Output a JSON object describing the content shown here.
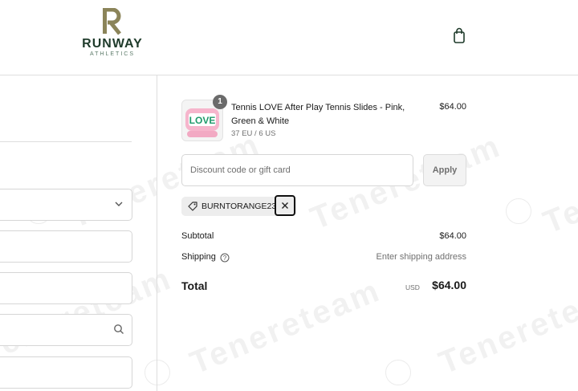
{
  "brand": {
    "name": "RUNWAY",
    "tagline": "ATHLETICS",
    "accent": "#1f3b2b",
    "monogram_color": "#8b8459"
  },
  "header": {
    "cart_icon": "shopping-bag-icon"
  },
  "cart_item": {
    "quantity": "1",
    "name": "Tennis LOVE After Play Tennis Slides - Pink, Green & White",
    "variant": "37 EU / 6 US",
    "price": "$64.00",
    "image_text": "LOVE"
  },
  "discount": {
    "placeholder": "Discount code or gift card",
    "value": "",
    "apply_label": "Apply"
  },
  "applied_code": {
    "code": "BURNTORANGE23",
    "tag_icon": "tag-icon",
    "remove_icon": "close-icon"
  },
  "totals": {
    "subtotal_label": "Subtotal",
    "subtotal_value": "$64.00",
    "shipping_label": "Shipping",
    "shipping_value": "Enter shipping address",
    "total_label": "Total",
    "currency": "USD",
    "total_value": "$64.00"
  },
  "watermark": {
    "text": "Tenereteam"
  }
}
